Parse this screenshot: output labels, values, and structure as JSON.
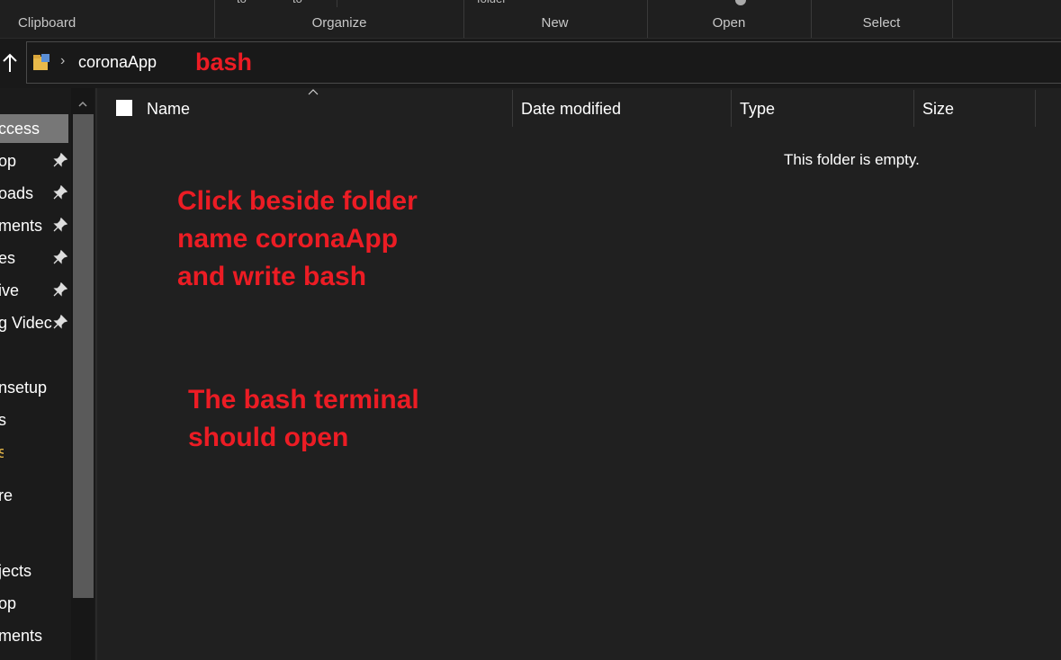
{
  "ribbon": {
    "groups": [
      "Clipboard",
      "Organize",
      "New",
      "Open",
      "Select"
    ],
    "cut_off_texts": [
      "to",
      "to",
      "folder"
    ]
  },
  "address_bar": {
    "breadcrumb": "coronaApp",
    "typed_text": "bash"
  },
  "navigation_pane": {
    "items": [
      "ccess",
      "op",
      "oads",
      "ments",
      "es",
      "ive",
      "g Videc",
      "nsetup",
      "s",
      "s",
      "re",
      "jects",
      "op",
      "ments"
    ],
    "selected_index": 0,
    "pinned_indices": [
      1,
      2,
      3,
      4,
      5,
      6
    ]
  },
  "file_list": {
    "columns": [
      "Name",
      "Date modified",
      "Type",
      "Size"
    ],
    "empty_message": "This folder is empty."
  },
  "annotations": {
    "instruction_lines": [
      "Click beside folder",
      "name coronaApp",
      "and write bash"
    ],
    "result_lines": [
      "The bash terminal",
      "should open"
    ],
    "color": "#ec1c24"
  },
  "theme": {
    "background": "#202020",
    "nav_background": "#1b1b1b",
    "selected_item": "#777777",
    "text": "#ffffff"
  }
}
